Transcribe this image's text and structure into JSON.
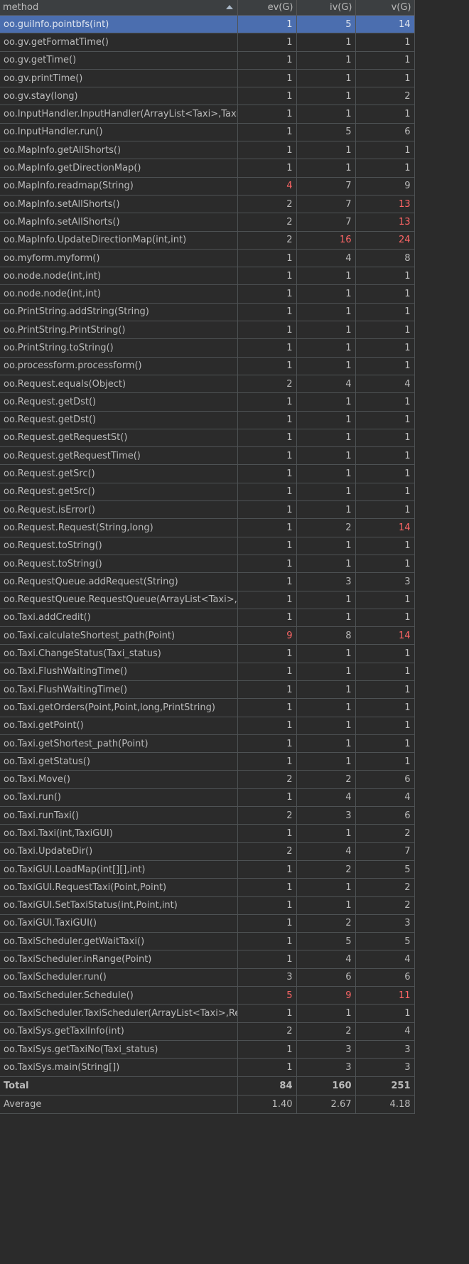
{
  "columns": [
    "method",
    "ev(G)",
    "iv(G)",
    "v(G)"
  ],
  "sort": {
    "column": "method",
    "direction": "ascending"
  },
  "colors": {
    "background": "#2b2b2b",
    "header": "#3c3f41",
    "selected": "#4b6eaf",
    "exceeded": "#ff6666",
    "text": "#bbbbbb"
  },
  "rows": [
    {
      "method": "oo.guiInfo.pointbfs(int)",
      "ev": "1",
      "iv": "5",
      "v": "14",
      "selected": true,
      "hot": []
    },
    {
      "method": "oo.gv.getFormatTime()",
      "ev": "1",
      "iv": "1",
      "v": "1",
      "hot": []
    },
    {
      "method": "oo.gv.getTime()",
      "ev": "1",
      "iv": "1",
      "v": "1",
      "hot": []
    },
    {
      "method": "oo.gv.printTime()",
      "ev": "1",
      "iv": "1",
      "v": "1",
      "hot": []
    },
    {
      "method": "oo.gv.stay(long)",
      "ev": "1",
      "iv": "1",
      "v": "2",
      "hot": []
    },
    {
      "method": "oo.InputHandler.InputHandler(ArrayList<Taxi>,Taxi",
      "ev": "1",
      "iv": "1",
      "v": "1",
      "hot": []
    },
    {
      "method": "oo.InputHandler.run()",
      "ev": "1",
      "iv": "5",
      "v": "6",
      "hot": []
    },
    {
      "method": "oo.MapInfo.getAllShorts()",
      "ev": "1",
      "iv": "1",
      "v": "1",
      "hot": []
    },
    {
      "method": "oo.MapInfo.getDirectionMap()",
      "ev": "1",
      "iv": "1",
      "v": "1",
      "hot": []
    },
    {
      "method": "oo.MapInfo.readmap(String)",
      "ev": "4",
      "iv": "7",
      "v": "9",
      "hot": [
        "ev"
      ]
    },
    {
      "method": "oo.MapInfo.setAllShorts()",
      "ev": "2",
      "iv": "7",
      "v": "13",
      "hot": [
        "v"
      ]
    },
    {
      "method": "oo.MapInfo.setAllShorts()",
      "ev": "2",
      "iv": "7",
      "v": "13",
      "hot": [
        "v"
      ]
    },
    {
      "method": "oo.MapInfo.UpdateDirectionMap(int,int)",
      "ev": "2",
      "iv": "16",
      "v": "24",
      "hot": [
        "iv",
        "v"
      ]
    },
    {
      "method": "oo.myform.myform()",
      "ev": "1",
      "iv": "4",
      "v": "8",
      "hot": []
    },
    {
      "method": "oo.node.node(int,int)",
      "ev": "1",
      "iv": "1",
      "v": "1",
      "hot": []
    },
    {
      "method": "oo.node.node(int,int)",
      "ev": "1",
      "iv": "1",
      "v": "1",
      "hot": []
    },
    {
      "method": "oo.PrintString.addString(String)",
      "ev": "1",
      "iv": "1",
      "v": "1",
      "hot": []
    },
    {
      "method": "oo.PrintString.PrintString()",
      "ev": "1",
      "iv": "1",
      "v": "1",
      "hot": []
    },
    {
      "method": "oo.PrintString.toString()",
      "ev": "1",
      "iv": "1",
      "v": "1",
      "hot": []
    },
    {
      "method": "oo.processform.processform()",
      "ev": "1",
      "iv": "1",
      "v": "1",
      "hot": []
    },
    {
      "method": "oo.Request.equals(Object)",
      "ev": "2",
      "iv": "4",
      "v": "4",
      "hot": []
    },
    {
      "method": "oo.Request.getDst()",
      "ev": "1",
      "iv": "1",
      "v": "1",
      "hot": []
    },
    {
      "method": "oo.Request.getDst()",
      "ev": "1",
      "iv": "1",
      "v": "1",
      "hot": []
    },
    {
      "method": "oo.Request.getRequestSt()",
      "ev": "1",
      "iv": "1",
      "v": "1",
      "hot": []
    },
    {
      "method": "oo.Request.getRequestTime()",
      "ev": "1",
      "iv": "1",
      "v": "1",
      "hot": []
    },
    {
      "method": "oo.Request.getSrc()",
      "ev": "1",
      "iv": "1",
      "v": "1",
      "hot": []
    },
    {
      "method": "oo.Request.getSrc()",
      "ev": "1",
      "iv": "1",
      "v": "1",
      "hot": []
    },
    {
      "method": "oo.Request.isError()",
      "ev": "1",
      "iv": "1",
      "v": "1",
      "hot": []
    },
    {
      "method": "oo.Request.Request(String,long)",
      "ev": "1",
      "iv": "2",
      "v": "14",
      "hot": [
        "v"
      ]
    },
    {
      "method": "oo.Request.toString()",
      "ev": "1",
      "iv": "1",
      "v": "1",
      "hot": []
    },
    {
      "method": "oo.Request.toString()",
      "ev": "1",
      "iv": "1",
      "v": "1",
      "hot": []
    },
    {
      "method": "oo.RequestQueue.addRequest(String)",
      "ev": "1",
      "iv": "3",
      "v": "3",
      "hot": []
    },
    {
      "method": "oo.RequestQueue.RequestQueue(ArrayList<Taxi>,",
      "ev": "1",
      "iv": "1",
      "v": "1",
      "hot": []
    },
    {
      "method": "oo.Taxi.addCredit()",
      "ev": "1",
      "iv": "1",
      "v": "1",
      "hot": []
    },
    {
      "method": "oo.Taxi.calculateShortest_path(Point)",
      "ev": "9",
      "iv": "8",
      "v": "14",
      "hot": [
        "ev",
        "v"
      ]
    },
    {
      "method": "oo.Taxi.ChangeStatus(Taxi_status)",
      "ev": "1",
      "iv": "1",
      "v": "1",
      "hot": []
    },
    {
      "method": "oo.Taxi.FlushWaitingTime()",
      "ev": "1",
      "iv": "1",
      "v": "1",
      "hot": []
    },
    {
      "method": "oo.Taxi.FlushWaitingTime()",
      "ev": "1",
      "iv": "1",
      "v": "1",
      "hot": []
    },
    {
      "method": "oo.Taxi.getOrders(Point,Point,long,PrintString)",
      "ev": "1",
      "iv": "1",
      "v": "1",
      "hot": []
    },
    {
      "method": "oo.Taxi.getPoint()",
      "ev": "1",
      "iv": "1",
      "v": "1",
      "hot": []
    },
    {
      "method": "oo.Taxi.getShortest_path(Point)",
      "ev": "1",
      "iv": "1",
      "v": "1",
      "hot": []
    },
    {
      "method": "oo.Taxi.getStatus()",
      "ev": "1",
      "iv": "1",
      "v": "1",
      "hot": []
    },
    {
      "method": "oo.Taxi.Move()",
      "ev": "2",
      "iv": "2",
      "v": "6",
      "hot": []
    },
    {
      "method": "oo.Taxi.run()",
      "ev": "1",
      "iv": "4",
      "v": "4",
      "hot": []
    },
    {
      "method": "oo.Taxi.runTaxi()",
      "ev": "2",
      "iv": "3",
      "v": "6",
      "hot": []
    },
    {
      "method": "oo.Taxi.Taxi(int,TaxiGUI)",
      "ev": "1",
      "iv": "1",
      "v": "2",
      "hot": []
    },
    {
      "method": "oo.Taxi.UpdateDir()",
      "ev": "2",
      "iv": "4",
      "v": "7",
      "hot": []
    },
    {
      "method": "oo.TaxiGUI.LoadMap(int[][],int)",
      "ev": "1",
      "iv": "2",
      "v": "5",
      "hot": []
    },
    {
      "method": "oo.TaxiGUI.RequestTaxi(Point,Point)",
      "ev": "1",
      "iv": "1",
      "v": "2",
      "hot": []
    },
    {
      "method": "oo.TaxiGUI.SetTaxiStatus(int,Point,int)",
      "ev": "1",
      "iv": "1",
      "v": "2",
      "hot": []
    },
    {
      "method": "oo.TaxiGUI.TaxiGUI()",
      "ev": "1",
      "iv": "2",
      "v": "3",
      "hot": []
    },
    {
      "method": "oo.TaxiScheduler.getWaitTaxi()",
      "ev": "1",
      "iv": "5",
      "v": "5",
      "hot": []
    },
    {
      "method": "oo.TaxiScheduler.inRange(Point)",
      "ev": "1",
      "iv": "4",
      "v": "4",
      "hot": []
    },
    {
      "method": "oo.TaxiScheduler.run()",
      "ev": "3",
      "iv": "6",
      "v": "6",
      "hot": []
    },
    {
      "method": "oo.TaxiScheduler.Schedule()",
      "ev": "5",
      "iv": "9",
      "v": "11",
      "hot": [
        "ev",
        "iv",
        "v"
      ]
    },
    {
      "method": "oo.TaxiScheduler.TaxiScheduler(ArrayList<Taxi>,Re",
      "ev": "1",
      "iv": "1",
      "v": "1",
      "hot": []
    },
    {
      "method": "oo.TaxiSys.getTaxiInfo(int)",
      "ev": "2",
      "iv": "2",
      "v": "4",
      "hot": []
    },
    {
      "method": "oo.TaxiSys.getTaxiNo(Taxi_status)",
      "ev": "1",
      "iv": "3",
      "v": "3",
      "hot": []
    },
    {
      "method": "oo.TaxiSys.main(String[])",
      "ev": "1",
      "iv": "3",
      "v": "3",
      "hot": []
    }
  ],
  "total": {
    "label": "Total",
    "ev": "84",
    "iv": "160",
    "v": "251"
  },
  "average": {
    "label": "Average",
    "ev": "1.40",
    "iv": "2.67",
    "v": "4.18"
  }
}
